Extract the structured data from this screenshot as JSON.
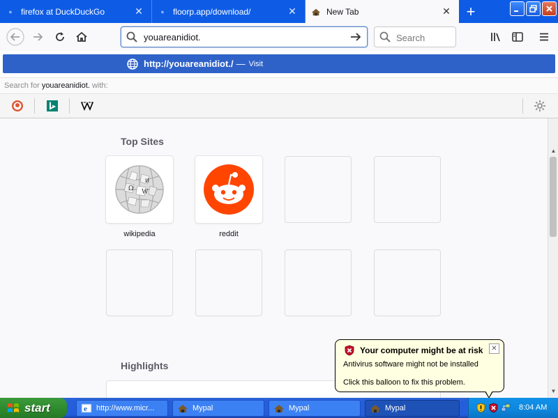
{
  "tabs": [
    {
      "title": "firefox at DuckDuckGo",
      "active": false
    },
    {
      "title": "floorp.app/download/",
      "active": false
    },
    {
      "title": "New Tab",
      "active": true
    }
  ],
  "urlbar": {
    "value": "youareanidiot."
  },
  "searchbar": {
    "placeholder": "Search"
  },
  "dropdown": {
    "suggest_url": "http://youareanidiot./",
    "suggest_separator": "—",
    "suggest_action": "Visit",
    "search_for_prefix": "Search for",
    "search_for_term": "youareanidiot.",
    "search_for_suffix": "with:",
    "engines": [
      "DuckDuckGo",
      "Bing",
      "Wikipedia"
    ]
  },
  "newtab": {
    "top_sites_heading": "Top Sites",
    "top_sites": [
      {
        "label": "wikipedia"
      },
      {
        "label": "reddit"
      }
    ],
    "highlights_heading": "Highlights"
  },
  "balloon": {
    "title": "Your computer might be at risk",
    "line1": "Antivirus software might not be installed",
    "line2": "Click this balloon to fix this problem."
  },
  "taskbar": {
    "start_label": "start",
    "tasks": [
      {
        "label": "http://www.micr...",
        "active": false
      },
      {
        "label": "Mypal",
        "active": false
      },
      {
        "label": "Mypal",
        "active": false
      },
      {
        "label": "Mypal",
        "active": true
      }
    ],
    "clock": "8:04 AM"
  },
  "colors": {
    "tab_strip": "#0e5ce5",
    "suggest_highlight": "#2e62c9",
    "balloon_bg": "#ffffe1",
    "taskbar": "#245edb",
    "start_button": "#2e8b2e",
    "reddit": "#ff4500"
  }
}
